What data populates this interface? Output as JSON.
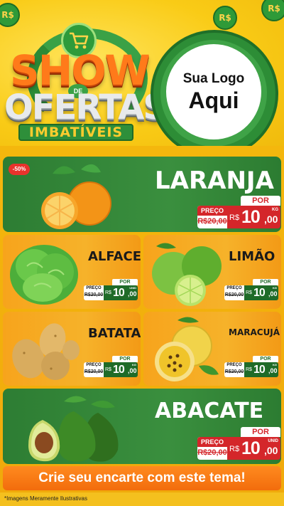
{
  "header": {
    "title_show": "SHOW",
    "title_de": "DE",
    "title_ofertas": "OFERTAS",
    "subtitle": "IMBATÍVEIS",
    "coin_symbol": "R$",
    "logo_line1": "Sua Logo",
    "logo_line2": "Aqui"
  },
  "products": [
    {
      "name": "LARANJA",
      "discount": "-50%",
      "por": "POR",
      "old_label": "PREÇO",
      "old_price": "R$20,00",
      "currency": "R$",
      "price": "10",
      "cents": ",00",
      "unit": "KG"
    },
    {
      "name": "ALFACE",
      "por": "POR",
      "old_label": "PREÇO",
      "old_price": "R$20,00",
      "currency": "R$",
      "price": "10",
      "cents": ",00",
      "unit": "UNID"
    },
    {
      "name": "LIMÃO",
      "por": "POR",
      "old_label": "PREÇO",
      "old_price": "R$20,00",
      "currency": "R$",
      "price": "10",
      "cents": ",00",
      "unit": "KG"
    },
    {
      "name": "BATATA",
      "por": "POR",
      "old_label": "PREÇO",
      "old_price": "R$20,00",
      "currency": "R$",
      "price": "10",
      "cents": ",00",
      "unit": "KG"
    },
    {
      "name": "MARACUJÁ",
      "por": "POR",
      "old_label": "PREÇO",
      "old_price": "R$20,00",
      "currency": "R$",
      "price": "10",
      "cents": ",00",
      "unit": "KG"
    },
    {
      "name": "ABACATE",
      "por": "POR",
      "old_label": "PREÇO",
      "old_price": "R$20,00",
      "currency": "R$",
      "price": "10",
      "cents": ",00",
      "unit": "UNID"
    }
  ],
  "cta": "Crie seu encarte com este tema!",
  "footer": "*Imagens Meramente Ilustrativas",
  "colors": {
    "green": "#2d7d33",
    "orange": "#f7a41c",
    "red": "#d4262a",
    "yellow": "#f7c81a"
  }
}
